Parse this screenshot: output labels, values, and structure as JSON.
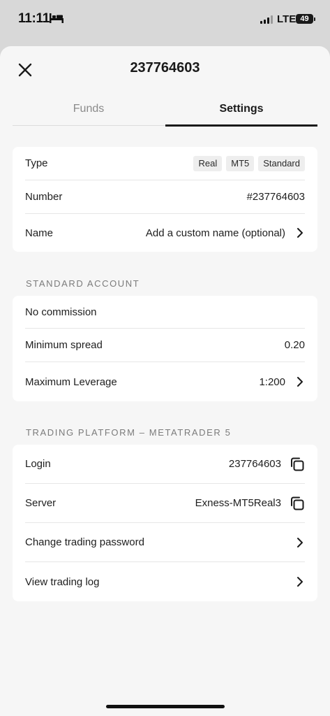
{
  "status_bar": {
    "time": "11:11",
    "network": "LTE",
    "battery": "49"
  },
  "header": {
    "title": "237764603"
  },
  "tabs": [
    {
      "label": "Funds"
    },
    {
      "label": "Settings"
    }
  ],
  "account_card": {
    "type_label": "Type",
    "badges": [
      "Real",
      "MT5",
      "Standard"
    ],
    "number_label": "Number",
    "number_value": "#237764603",
    "name_label": "Name",
    "name_value": "Add a custom name (optional)"
  },
  "standard_account": {
    "header": "STANDARD ACCOUNT",
    "commission": "No commission",
    "spread_label": "Minimum spread",
    "spread_value": "0.20",
    "leverage_label": "Maximum Leverage",
    "leverage_value": "1:200"
  },
  "platform": {
    "header": "TRADING PLATFORM – METATRADER 5",
    "login_label": "Login",
    "login_value": "237764603",
    "server_label": "Server",
    "server_value": "Exness-MT5Real3",
    "change_password": "Change trading password",
    "view_log": "View trading log"
  },
  "icons": {
    "close": "close-icon",
    "chevron": "chevron-right-icon",
    "copy": "copy-icon",
    "bed": "bed-icon",
    "signal": "signal-icon",
    "battery": "battery-icon"
  }
}
